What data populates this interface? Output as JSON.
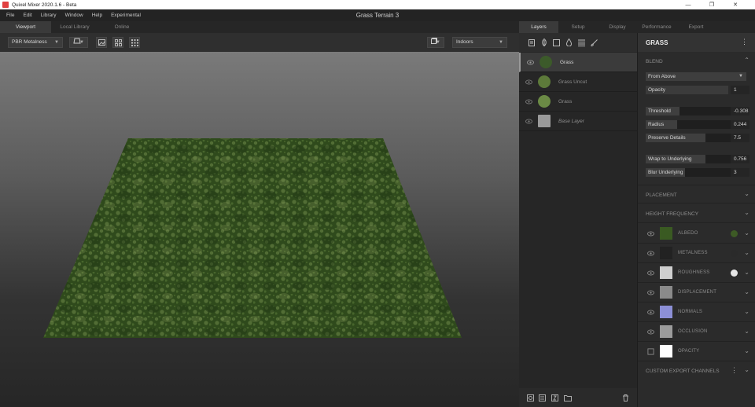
{
  "window": {
    "app_title": "Quixel Mixer 2020.1.6 - Beta",
    "document_title": "Grass Terrain 3",
    "minimize": "—",
    "maximize": "❐",
    "close": "✕"
  },
  "menu": [
    "File",
    "Edit",
    "Library",
    "Window",
    "Help",
    "Experimental"
  ],
  "left_tabs": [
    "Viewport",
    "Local Library",
    "Online"
  ],
  "right_tabs": [
    "Layers",
    "Setup",
    "Display",
    "Performance",
    "Export"
  ],
  "viewport_toolbar": {
    "render_mode": "PBR Metalness",
    "environment": "Indoors"
  },
  "layers": [
    {
      "name": "Grass",
      "style": "normal",
      "thumb": "#3c5a2a"
    },
    {
      "name": "Grass Uncut",
      "style": "dim",
      "thumb": "#5d7a3a"
    },
    {
      "name": "Grass",
      "style": "dim",
      "thumb": "#6b8a45"
    },
    {
      "name": "Base Layer",
      "style": "italic",
      "thumb": "#9a9a9a"
    }
  ],
  "properties": {
    "title": "GRASS",
    "blend": {
      "label": "BLEND",
      "mode": "From Above",
      "opacity_label": "Opacity",
      "opacity_value": "1",
      "sliders": [
        {
          "label": "Threshold",
          "value": "-0.308",
          "level": 0.38
        },
        {
          "label": "Radius",
          "value": "0.244",
          "level": 0.36
        },
        {
          "label": "Preserve Details",
          "value": "7.5",
          "level": 0.68
        },
        {
          "label": "Wrap to Underlying",
          "value": "0.756",
          "level": 0.68
        },
        {
          "label": "Blur Underlying",
          "value": "3",
          "level": 0.45
        }
      ]
    },
    "placement_label": "PLACEMENT",
    "height_frequency_label": "HEIGHT FREQUENCY",
    "channels": [
      {
        "name": "ALBEDO",
        "thumb": "#3a5a22",
        "dot": "#3d5a25"
      },
      {
        "name": "METALNESS",
        "thumb": "#222222",
        "dot": "#2a2a2a"
      },
      {
        "name": "ROUGHNESS",
        "thumb": "#cfcfcf",
        "dot": "#e6e6e6"
      },
      {
        "name": "DISPLACEMENT",
        "thumb": "#8a8a8a",
        "dot": ""
      },
      {
        "name": "NORMALS",
        "thumb": "#8c8fd6",
        "dot": ""
      },
      {
        "name": "OCCLUSION",
        "thumb": "#9c9c9c",
        "dot": ""
      },
      {
        "name": "OPACITY",
        "thumb": "#ffffff",
        "dot": ""
      }
    ],
    "custom_export_label": "CUSTOM EXPORT CHANNELS"
  },
  "colors": {
    "grass_dark": "#2f4a1c",
    "grass_light": "#6f8a48",
    "panel": "#2b2b2b"
  }
}
